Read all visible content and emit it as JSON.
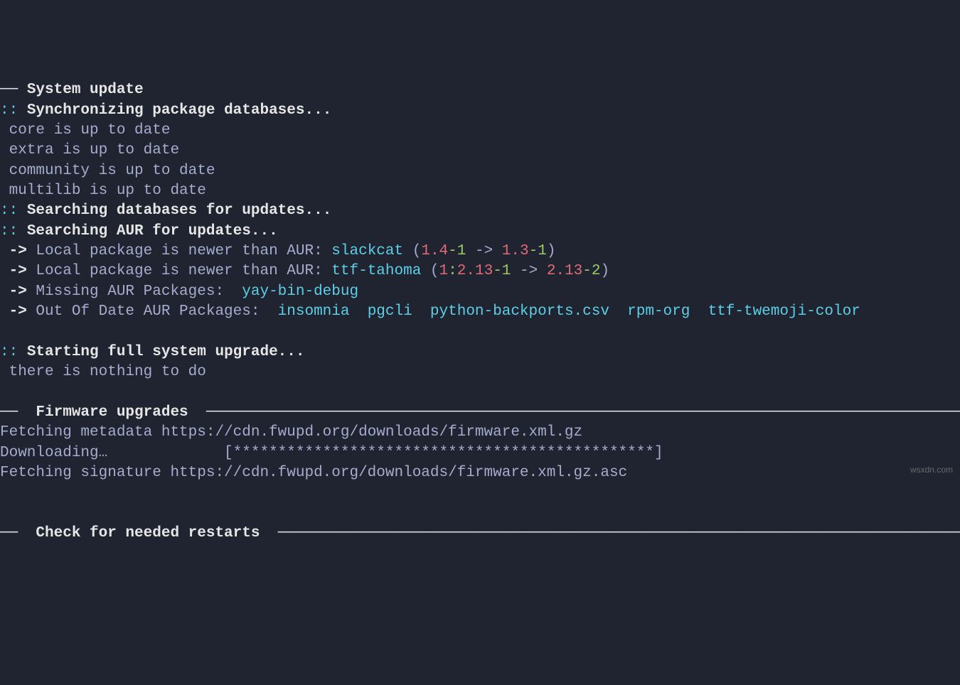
{
  "header": {
    "system_update": "System update"
  },
  "sync": {
    "prefix": "::",
    "msg": " Synchronizing package databases...",
    "repos": [
      " core is up to date",
      " extra is up to date",
      " community is up to date",
      " multilib is up to date"
    ]
  },
  "search": {
    "db": " Searching databases for updates...",
    "aur": " Searching AUR for updates..."
  },
  "arrow": " ->",
  "local_newer": {
    "prefix": " Local package is newer than AUR: ",
    "item1": {
      "name": "slackcat",
      "open": " (",
      "v1_a": "1.4",
      "v1_b": "-1",
      "sep": " -> ",
      "v2_a": "1.3",
      "v2_b": "-1",
      "close": ")"
    },
    "item2": {
      "name": "ttf-tahoma",
      "open": " (",
      "v1_a": "1",
      "v1_b": ":",
      "v1_c": "2.13",
      "v1_d": "-1",
      "sep": " -> ",
      "v2_a": "2.13",
      "v2_b": "-2",
      "close": ")"
    }
  },
  "missing": {
    "label": " Missing AUR Packages:  ",
    "pkg": "yay-bin-debug"
  },
  "outofdate": {
    "label": " Out Of Date AUR Packages:  ",
    "pkgs": "insomnia  pgcli  python-backports.csv  rpm-org  ttf-twemoji-color"
  },
  "upgrade": {
    "start": " Starting full system upgrade...",
    "nothing": " there is nothing to do"
  },
  "firmware": {
    "title": " Firmware upgrades ",
    "fetch_meta": "Fetching metadata https://cdn.fwupd.org/downloads/firmware.xml.gz",
    "downloading": "Downloading…             [***********************************************]",
    "fetch_sig": "Fetching signature https://cdn.fwupd.org/downloads/firmware.xml.gz.asc"
  },
  "restarts": {
    "title": " Check for needed restarts "
  },
  "divider_left": "── ",
  "divider_right_long": " ──────────────────────────────────────────────────────────────────────────────────────────────────────────────",
  "divider_right_long2": " ───────────────────────────────────────────────────────────────────────────────────────────────────────",
  "watermark": "wsxdn.com"
}
